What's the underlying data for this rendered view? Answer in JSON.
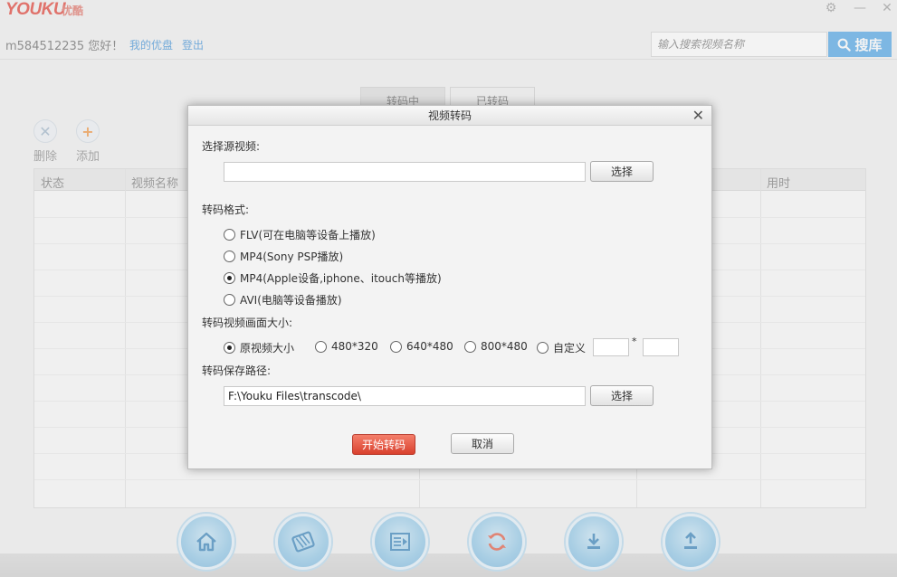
{
  "app": {
    "logo": "YOUKU",
    "logo_cn": "优酷",
    "window": {
      "settings": "⚙",
      "minimize": "—",
      "close": "✕"
    }
  },
  "user": {
    "greeting": "m584512235 您好！",
    "my_youku": "我的优盘",
    "logout": "登出"
  },
  "search": {
    "placeholder": "输入搜索视频名称",
    "button": "搜库"
  },
  "background_tabs": [
    "转码中",
    "已转码"
  ],
  "toolbar": {
    "delete": "删除",
    "add": "添加"
  },
  "table": {
    "headers": [
      "状态",
      "视频名称",
      "用时"
    ]
  },
  "dialog": {
    "title": "视频转码",
    "source_label": "选择源视频:",
    "source_value": "",
    "browse": "选择",
    "format_label": "转码格式:",
    "formats": [
      {
        "label": "FLV(可在电脑等设备上播放)",
        "checked": false
      },
      {
        "label": "MP4(Sony PSP播放)",
        "checked": false
      },
      {
        "label": "MP4(Apple设备,iphone、itouch等播放)",
        "checked": true
      },
      {
        "label": "AVI(电脑等设备播放)",
        "checked": false
      }
    ],
    "size_label": "转码视频画面大小:",
    "sizes": [
      {
        "label": "原视频大小",
        "checked": true
      },
      {
        "label": "480*320",
        "checked": false
      },
      {
        "label": "640*480",
        "checked": false
      },
      {
        "label": "800*480",
        "checked": false
      },
      {
        "label": "自定义",
        "checked": false
      }
    ],
    "custom_sep": "*",
    "path_label": "转码保存路径:",
    "path_value": "F:\\Youku Files\\transcode\\",
    "start": "开始转码",
    "cancel": "取消"
  },
  "colors": {
    "brand": "#e23a2f",
    "search_button": "#4ba3e7",
    "start_button": "#d9412e",
    "link": "#3a8fd8"
  }
}
